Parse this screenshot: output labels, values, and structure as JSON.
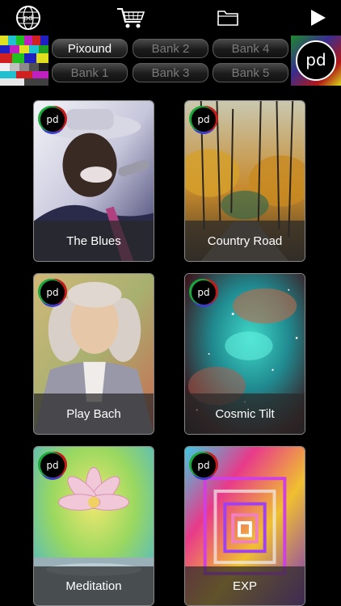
{
  "toolbar": {
    "icons": [
      "pd-globe-icon",
      "cart-icon",
      "folder-icon",
      "play-icon"
    ]
  },
  "banks": {
    "items": [
      {
        "label": "Pixound",
        "active": true
      },
      {
        "label": "Bank 2",
        "active": false
      },
      {
        "label": "Bank 4",
        "active": false
      },
      {
        "label": "Bank 1",
        "active": false
      },
      {
        "label": "Bank 3",
        "active": false
      },
      {
        "label": "Bank 5",
        "active": false
      }
    ]
  },
  "cards": [
    {
      "title": "The Blues"
    },
    {
      "title": "Country Road"
    },
    {
      "title": "Play Bach"
    },
    {
      "title": "Cosmic Tilt"
    },
    {
      "title": "Meditation"
    },
    {
      "title": "EXP"
    }
  ],
  "colors": {
    "background": "#000000",
    "label_bar": "#282828",
    "bank_inactive_text": "#7a7a7a",
    "bank_active_text": "#ffffff"
  }
}
